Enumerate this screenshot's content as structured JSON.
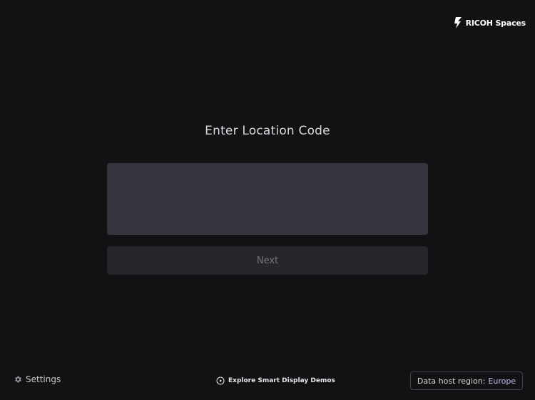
{
  "brand": {
    "logo_text": "RICOH Spaces",
    "icon": "ricoh-spaces-logo-icon"
  },
  "main": {
    "title": "Enter Location Code",
    "code_input": {
      "value": "",
      "placeholder": ""
    },
    "next_label": "Next"
  },
  "footer": {
    "settings_label": "Settings",
    "settings_icon": "gear-icon",
    "explore_label": "Explore Smart Display Demos",
    "explore_icon": "play-circle-icon",
    "region_label": "Data host region:",
    "region_value": "Europe"
  },
  "colors": {
    "background": "#121214",
    "input_bg": "#36343d",
    "button_bg": "#27262b",
    "accent": "#c9b6f0"
  }
}
